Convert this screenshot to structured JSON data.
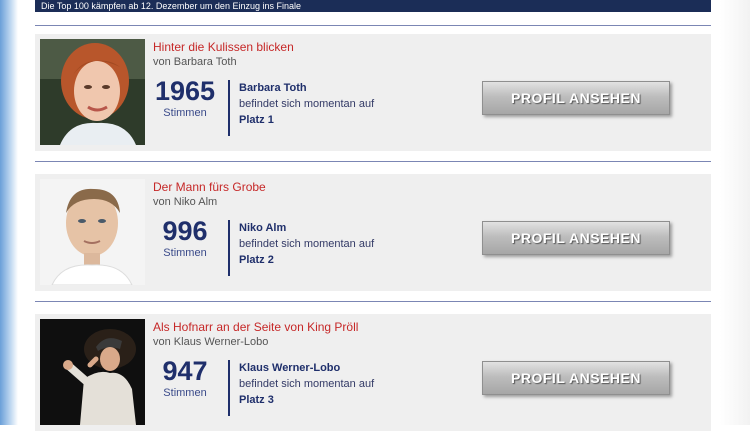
{
  "header": {
    "text": "Die Top 100 kämpfen ab 12. Dezember um den Einzug ins Finale"
  },
  "entries": [
    {
      "title": "Hinter die Kulissen blicken",
      "author": "von Barbara Toth",
      "votes": "1965",
      "votes_label": "Stimmen",
      "name": "Barbara Toth",
      "status": "befindet sich momentan auf",
      "rank": "Platz 1",
      "button": "PROFIL ANSEHEN"
    },
    {
      "title": "Der Mann fürs Grobe",
      "author": "von Niko Alm",
      "votes": "996",
      "votes_label": "Stimmen",
      "name": "Niko Alm",
      "status": "befindet sich momentan auf",
      "rank": "Platz 2",
      "button": "PROFIL ANSEHEN"
    },
    {
      "title": "Als Hofnarr an der Seite von King Pröll",
      "author": "von Klaus Werner-Lobo",
      "votes": "947",
      "votes_label": "Stimmen",
      "name": "Klaus Werner-Lobo",
      "status": "befindet sich momentan auf",
      "rank": "Platz 3",
      "button": "PROFIL ANSEHEN"
    }
  ]
}
